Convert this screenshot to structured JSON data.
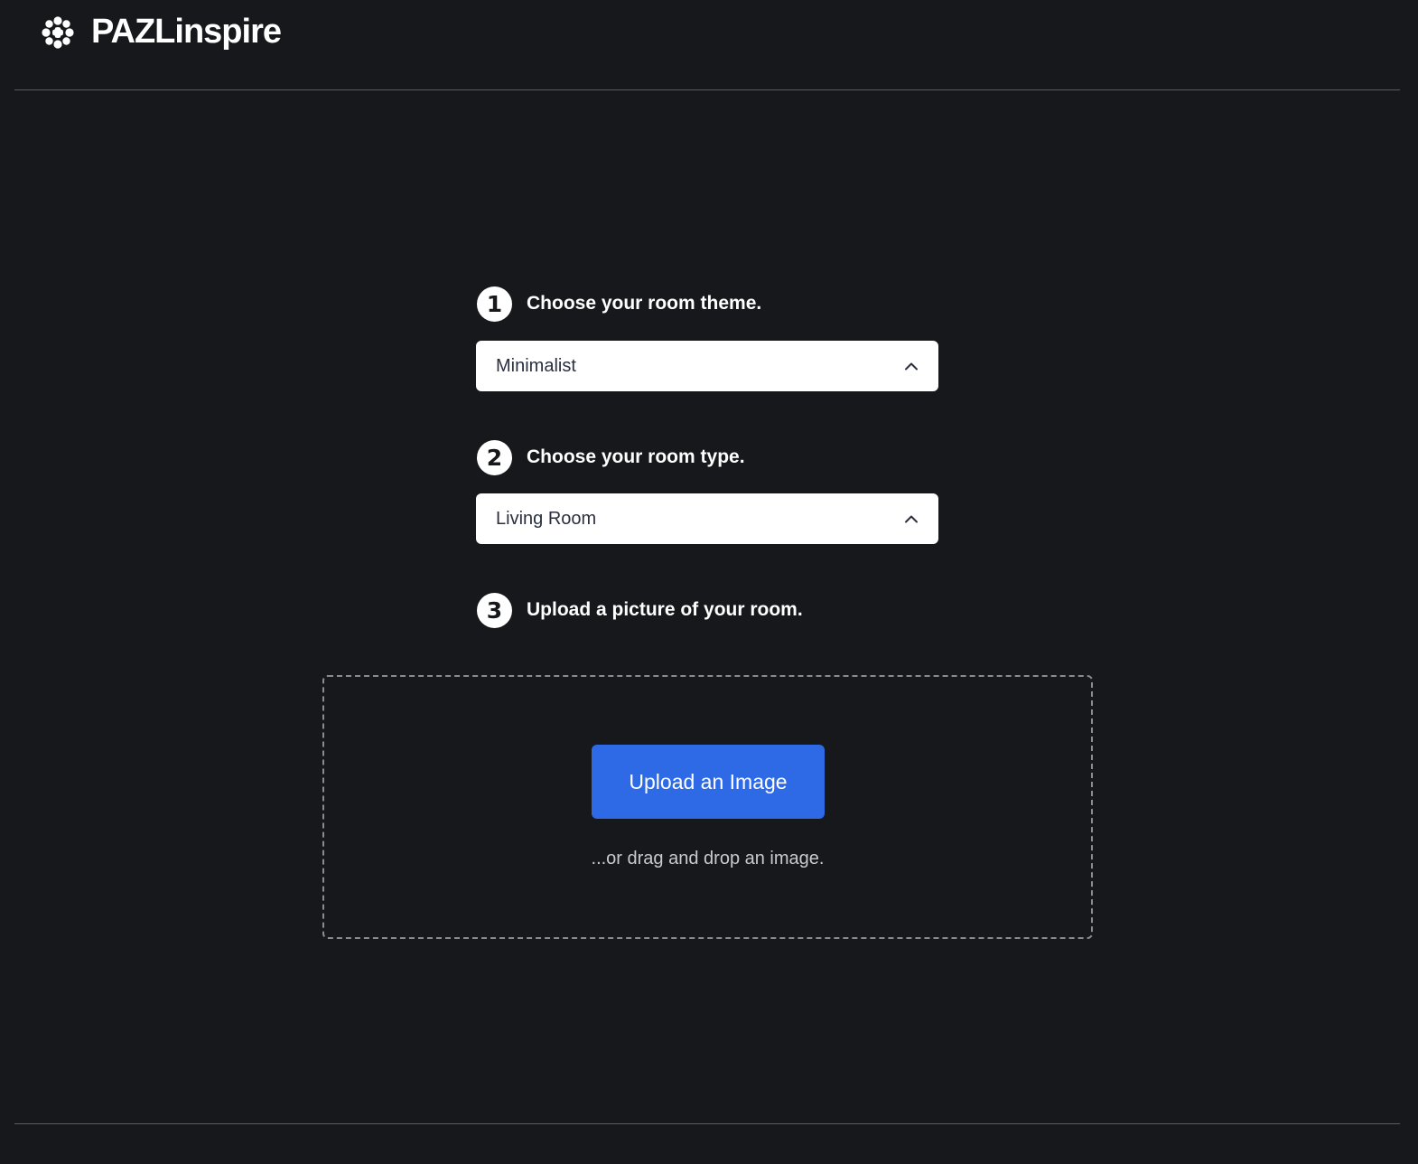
{
  "header": {
    "brand": "PAZLinspire",
    "logo_icon": "pazl-logo-icon"
  },
  "steps": [
    {
      "number": "1",
      "label": "Choose your room theme."
    },
    {
      "number": "2",
      "label": "Choose your room type."
    },
    {
      "number": "3",
      "label": "Upload a picture of your room."
    }
  ],
  "theme_select": {
    "value": "Minimalist",
    "icon": "chevron-up-icon"
  },
  "room_type_select": {
    "value": "Living Room",
    "icon": "chevron-up-icon"
  },
  "upload": {
    "button_label": "Upload an Image",
    "hint": "...or drag and drop an image."
  },
  "colors": {
    "background": "#17181c",
    "accent": "#2e6ae6",
    "text": "#ffffff"
  }
}
